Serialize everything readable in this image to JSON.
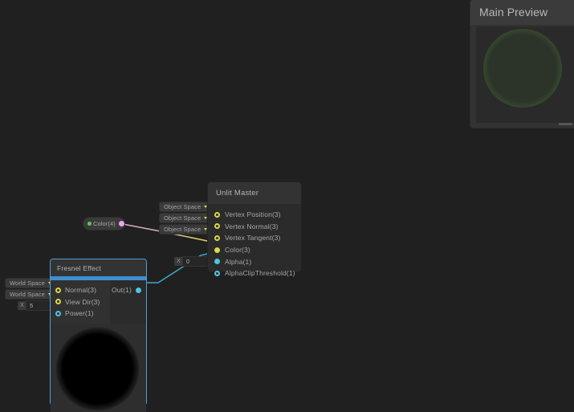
{
  "app": {
    "background_color": "#202020"
  },
  "main_preview": {
    "title": "Main Preview",
    "preview_shape": "sphere-green-fresnel-rim",
    "resize_handle": "resize-grip"
  },
  "nodes": {
    "unlit_master": {
      "title": "Unlit Master",
      "ports": [
        {
          "label": "Vertex Position(3)",
          "dot": "yellow-hollow",
          "widget": "Object Space"
        },
        {
          "label": "Vertex Normal(3)",
          "dot": "yellow-hollow",
          "widget": "Object Space"
        },
        {
          "label": "Vertex Tangent(3)",
          "dot": "yellow-hollow",
          "widget": "Object Space"
        },
        {
          "label": "Color(3)",
          "dot": "yellow-solid",
          "widget": ""
        },
        {
          "label": "Alpha(1)",
          "dot": "cyan-solid",
          "widget": ""
        },
        {
          "label": "AlphaClipThreshold(1)",
          "dot": "cyan-hollow",
          "widget": "X 0"
        }
      ],
      "widgets": {
        "vertex_position_space": "Object Space",
        "vertex_normal_space": "Object Space",
        "vertex_tangent_space": "Object Space",
        "alpha_clip_threshold_axis": "X",
        "alpha_clip_threshold_value": "0"
      }
    },
    "color4": {
      "label": "Color(4)",
      "input_dot": "green-solid",
      "output_dot": "pink-solid"
    },
    "fresnel_effect": {
      "title": "Fresnel Effect",
      "selected": true,
      "accent_color": "#3f8fd0",
      "inputs": [
        {
          "label": "Normal(3)",
          "dot": "yellow-hollow",
          "widget": "World Space"
        },
        {
          "label": "View Dir(3)",
          "dot": "yellow-hollow",
          "widget": "World Space"
        },
        {
          "label": "Power(1)",
          "dot": "cyan-hollow",
          "widget": "X 5"
        }
      ],
      "outputs": [
        {
          "label": "Out(1)",
          "dot": "cyan-solid"
        }
      ],
      "widgets": {
        "normal_space": "World Space",
        "view_dir_space": "World Space",
        "power_axis": "X",
        "power_value": "5"
      },
      "preview_shape": "sphere-white-fresnel-rim"
    }
  },
  "wires": [
    {
      "name": "color4-to-color3",
      "from": "Color(4).out",
      "to": "Unlit Master.Color(3)",
      "color_start": "#d7a6cf",
      "color_end": "#d8d84a"
    },
    {
      "name": "fresnel-to-alpha",
      "from": "Fresnel Effect.Out(1)",
      "to": "Unlit Master.Alpha(1)",
      "color_start": "#4fc5e0",
      "color_end": "#4fc5e0"
    }
  ],
  "colors": {
    "accent_blue": "#3f8fd0",
    "port_yellow": "#d8d84a",
    "port_cyan": "#4fc5e0",
    "port_green": "#5ecb4e",
    "port_pink": "#e9a7e9",
    "preview_green": "#7cc446",
    "node_body": "#2b2b2b",
    "node_header": "#333333",
    "canvas_bg": "#202020"
  }
}
